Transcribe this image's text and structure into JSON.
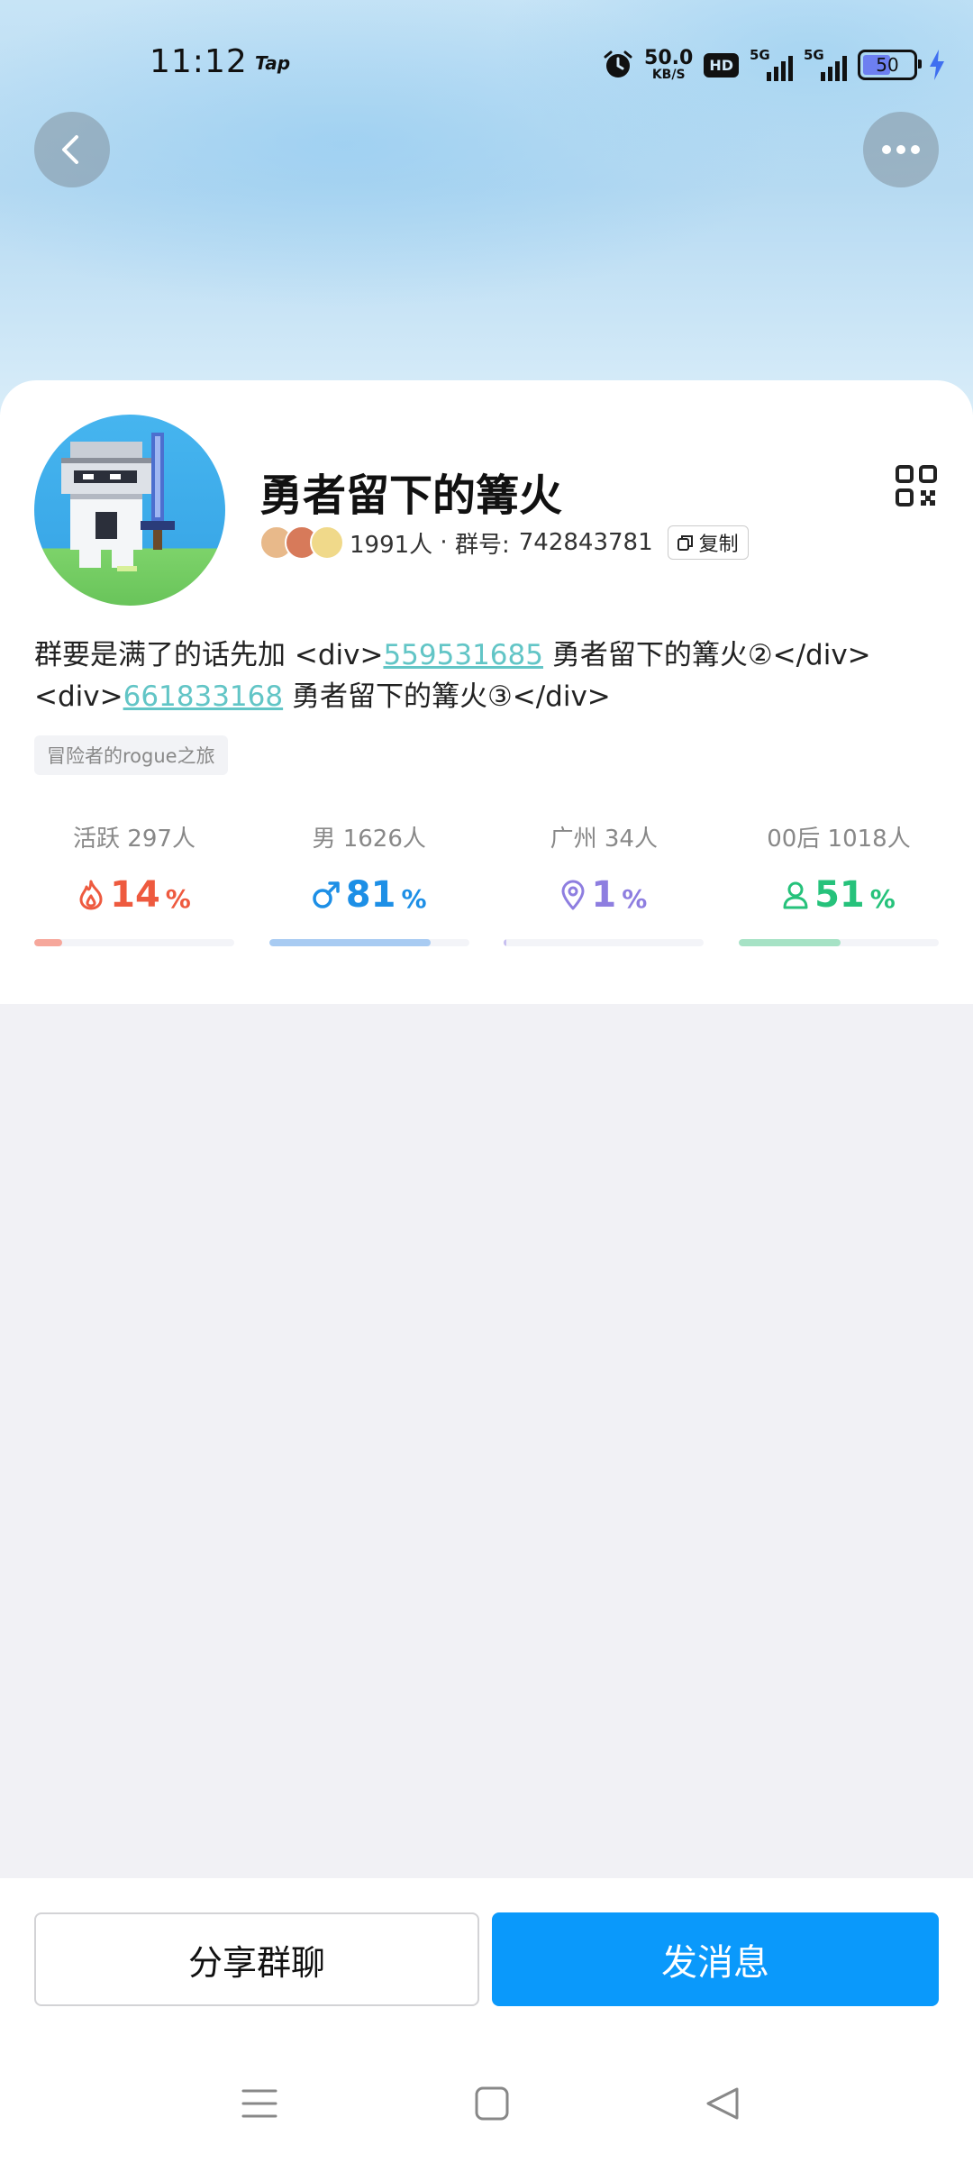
{
  "status_bar": {
    "time": "11:12",
    "app_badge": "Tap",
    "net_speed_value": "50.0",
    "net_speed_unit": "KB/S",
    "hd_label": "HD",
    "signal1_label": "5G",
    "signal2_label": "5G",
    "battery_level": "50"
  },
  "header": {
    "back_icon": "chevron-left-icon",
    "more_icon": "more-dots-icon"
  },
  "group": {
    "name": "勇者留下的篝火",
    "member_count": "1991人",
    "separator": " · ",
    "id_label": "群号:",
    "id_value": "742843781",
    "copy_label": "复制",
    "desc_part1": "群要是满了的话先加 <div>",
    "desc_link1": "559531685",
    "desc_part2": " 勇者留下的篝火②</div><div>",
    "desc_link2": "661833168",
    "desc_part3": " 勇者留下的篝火③</div>",
    "tag": "冒险者的rogue之旅"
  },
  "stats": [
    {
      "label": "活跃 297人",
      "value": "14",
      "unit": "%",
      "color": "#ee5a3f",
      "bar_color": "#f6a79b",
      "icon": "flame-icon",
      "fraction": 0.14
    },
    {
      "label": "男 1626人",
      "value": "81",
      "unit": "%",
      "color": "#1d8fe6",
      "bar_color": "#a8cbf2",
      "icon": "male-icon",
      "fraction": 0.81
    },
    {
      "label": "广州 34人",
      "value": "1",
      "unit": "%",
      "color": "#8e7ee0",
      "bar_color": "#c7bff0",
      "icon": "location-pin-icon",
      "fraction": 0.01
    },
    {
      "label": "00后 1018人",
      "value": "51",
      "unit": "%",
      "color": "#26c27b",
      "bar_color": "#a6e2c5",
      "icon": "person-icon",
      "fraction": 0.51
    }
  ],
  "actions": {
    "share_label": "分享群聊",
    "send_label": "发消息"
  },
  "colors": {
    "primary": "#0a99fb",
    "link": "#62c5c6"
  }
}
